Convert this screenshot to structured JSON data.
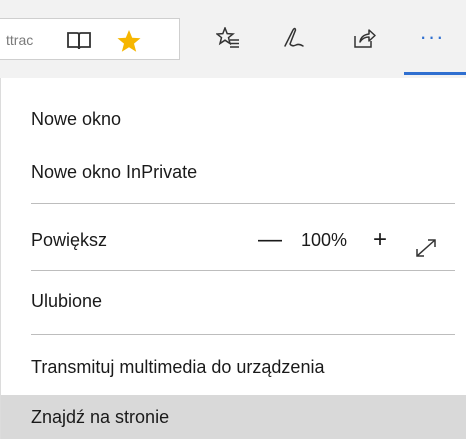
{
  "toolbar": {
    "address_fragment": "ttrac",
    "icons": {
      "reading_view": "reading-view-icon",
      "favorite": "star-icon",
      "hub": "hub-icon",
      "notes": "web-note-icon",
      "share": "share-icon",
      "more": "more-icon"
    },
    "more_label": "···",
    "accent_color": "#2f6fd0",
    "star_color": "#f6b600"
  },
  "menu": {
    "new_window": "Nowe okno",
    "new_inprivate": "Nowe okno InPrivate",
    "zoom": {
      "label": "Powiększ",
      "minus": "—",
      "level": "100%",
      "plus": "+"
    },
    "favorites": "Ulubione",
    "cast": "Transmituj multimedia do urządzenia",
    "find": "Znajdź na stronie"
  }
}
